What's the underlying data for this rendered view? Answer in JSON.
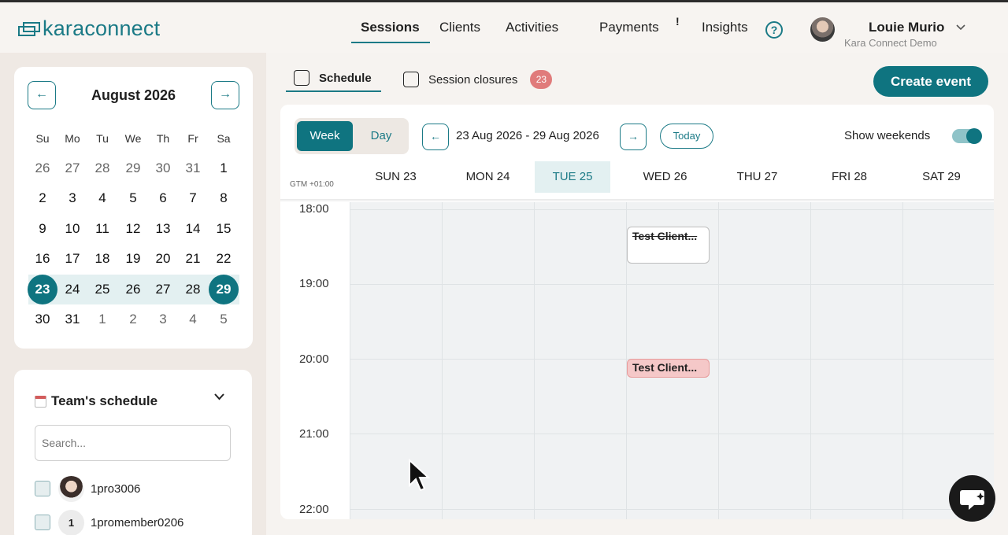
{
  "brand": {
    "logo_text": "karaconnect"
  },
  "nav": {
    "items": [
      {
        "label": "Sessions",
        "active": true
      },
      {
        "label": "Clients"
      },
      {
        "label": "Activities"
      },
      {
        "label": "Payments",
        "alert": "!"
      },
      {
        "label": "Insights"
      }
    ],
    "help_icon_text": "?"
  },
  "user": {
    "name": "Louie Murio",
    "org": "Kara Connect Demo"
  },
  "mini_calendar": {
    "month": "August 2026",
    "prev_icon": "←",
    "next_icon": "→",
    "dow": [
      "Su",
      "Mo",
      "Tu",
      "We",
      "Th",
      "Fr",
      "Sa"
    ],
    "weeks": [
      [
        "26",
        "27",
        "28",
        "29",
        "30",
        "31",
        "1"
      ],
      [
        "2",
        "3",
        "4",
        "5",
        "6",
        "7",
        "8"
      ],
      [
        "9",
        "10",
        "11",
        "12",
        "13",
        "14",
        "15"
      ],
      [
        "16",
        "17",
        "18",
        "19",
        "20",
        "21",
        "22"
      ],
      [
        "23",
        "24",
        "25",
        "26",
        "27",
        "28",
        "29"
      ],
      [
        "30",
        "31",
        "1",
        "2",
        "3",
        "4",
        "5"
      ]
    ]
  },
  "team": {
    "title": "Team's schedule",
    "search_placeholder": "Search...",
    "members": [
      {
        "name": "1pro3006",
        "avatar": ""
      },
      {
        "name": "1promember0206",
        "avatar": "1"
      }
    ]
  },
  "tabs": {
    "schedule": "Schedule",
    "closures": "Session closures",
    "closures_count": "23"
  },
  "create_event": "Create event",
  "week_view": {
    "week_label": "Week",
    "day_label": "Day",
    "range": "23 Aug 2026 - 29 Aug 2026",
    "today_label": "Today",
    "show_weekends_label": "Show weekends",
    "show_weekends": true,
    "timezone": "GTM +01:00",
    "days": [
      "SUN  23",
      "MON  24",
      "TUE  25",
      "WED  26",
      "THU  27",
      "FRI  28",
      "SAT  29"
    ],
    "today_index": 2,
    "times": [
      "18:00",
      "19:00",
      "20:00",
      "21:00",
      "22:00"
    ],
    "events": [
      {
        "title": "Test Client...",
        "day": "WED  26",
        "style": "cancelled"
      },
      {
        "title": "Test Client...",
        "day": "WED  26",
        "style": "pink"
      }
    ]
  },
  "colors": {
    "accent": "#0f7480",
    "badge": "#e07b7b",
    "event_pink": "#f5c8c8"
  }
}
